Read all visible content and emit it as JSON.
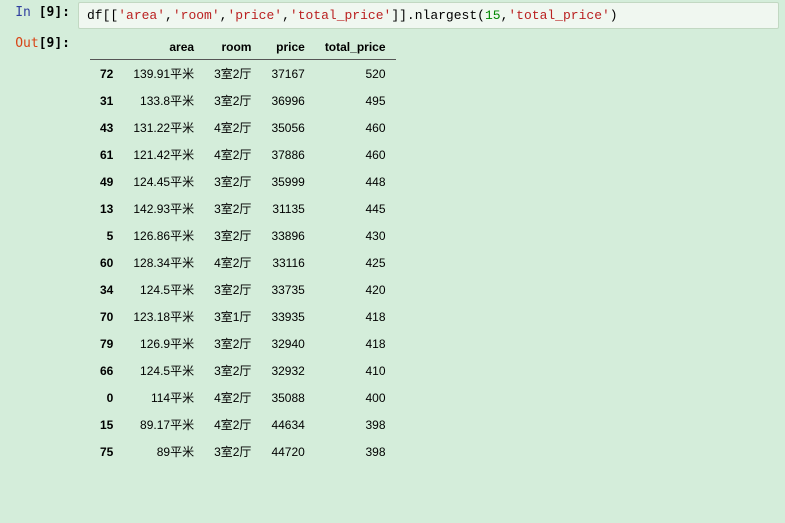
{
  "input": {
    "prompt_label": "In ",
    "prompt_num": "[9]:",
    "code_parts": [
      {
        "t": "n",
        "v": "df"
      },
      {
        "t": "p",
        "v": "[["
      },
      {
        "t": "s",
        "v": "'area'"
      },
      {
        "t": "p",
        "v": ","
      },
      {
        "t": "s",
        "v": "'room'"
      },
      {
        "t": "p",
        "v": ","
      },
      {
        "t": "s",
        "v": "'price'"
      },
      {
        "t": "p",
        "v": ","
      },
      {
        "t": "s",
        "v": "'total_price'"
      },
      {
        "t": "p",
        "v": "]]."
      },
      {
        "t": "n",
        "v": "nlargest"
      },
      {
        "t": "p",
        "v": "("
      },
      {
        "t": "m",
        "v": "15"
      },
      {
        "t": "p",
        "v": ","
      },
      {
        "t": "s",
        "v": "'total_price'"
      },
      {
        "t": "p",
        "v": ")"
      }
    ]
  },
  "output": {
    "prompt_label": "Out",
    "prompt_num": "[9]:",
    "columns": [
      "area",
      "room",
      "price",
      "total_price"
    ],
    "rows": [
      {
        "idx": "72",
        "area": "139.91平米",
        "room": "3室2厅",
        "price": "37167",
        "total_price": "520"
      },
      {
        "idx": "31",
        "area": "133.8平米",
        "room": "3室2厅",
        "price": "36996",
        "total_price": "495"
      },
      {
        "idx": "43",
        "area": "131.22平米",
        "room": "4室2厅",
        "price": "35056",
        "total_price": "460"
      },
      {
        "idx": "61",
        "area": "121.42平米",
        "room": "4室2厅",
        "price": "37886",
        "total_price": "460"
      },
      {
        "idx": "49",
        "area": "124.45平米",
        "room": "3室2厅",
        "price": "35999",
        "total_price": "448"
      },
      {
        "idx": "13",
        "area": "142.93平米",
        "room": "3室2厅",
        "price": "31135",
        "total_price": "445"
      },
      {
        "idx": "5",
        "area": "126.86平米",
        "room": "3室2厅",
        "price": "33896",
        "total_price": "430"
      },
      {
        "idx": "60",
        "area": "128.34平米",
        "room": "4室2厅",
        "price": "33116",
        "total_price": "425"
      },
      {
        "idx": "34",
        "area": "124.5平米",
        "room": "3室2厅",
        "price": "33735",
        "total_price": "420"
      },
      {
        "idx": "70",
        "area": "123.18平米",
        "room": "3室1厅",
        "price": "33935",
        "total_price": "418"
      },
      {
        "idx": "79",
        "area": "126.9平米",
        "room": "3室2厅",
        "price": "32940",
        "total_price": "418"
      },
      {
        "idx": "66",
        "area": "124.5平米",
        "room": "3室2厅",
        "price": "32932",
        "total_price": "410"
      },
      {
        "idx": "0",
        "area": "114平米",
        "room": "4室2厅",
        "price": "35088",
        "total_price": "400"
      },
      {
        "idx": "15",
        "area": "89.17平米",
        "room": "4室2厅",
        "price": "44634",
        "total_price": "398"
      },
      {
        "idx": "75",
        "area": "89平米",
        "room": "3室2厅",
        "price": "44720",
        "total_price": "398"
      }
    ]
  }
}
